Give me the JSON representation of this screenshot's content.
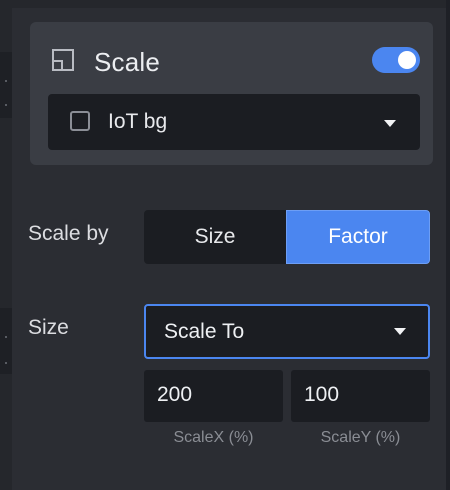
{
  "layer": {
    "title": "Scale",
    "enabled": true,
    "background_select": {
      "value": "IoT bg"
    }
  },
  "scale_by": {
    "label": "Scale by",
    "options": [
      "Size",
      "Factor"
    ],
    "selected": "Factor"
  },
  "size": {
    "label": "Size",
    "mode_select": {
      "value": "Scale To"
    },
    "fields": [
      {
        "value": "200",
        "caption": "ScaleX (%)"
      },
      {
        "value": "100",
        "caption": "ScaleY (%)"
      }
    ]
  },
  "colors": {
    "accent": "#4b86f0",
    "panel": "#2b2d33",
    "card": "#3a3d44",
    "input": "#1b1d22"
  },
  "icons": {
    "layer": "frame-icon",
    "toggle": "toggle-switch",
    "dropdown": "caret-down-icon",
    "swatch": "color-swatch"
  }
}
